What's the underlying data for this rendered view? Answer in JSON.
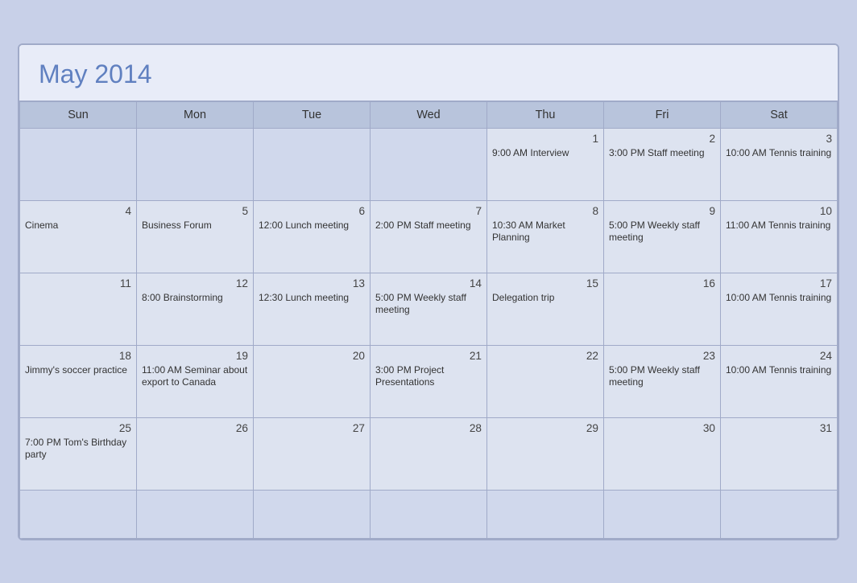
{
  "calendar": {
    "title": "May 2014",
    "headers": [
      "Sun",
      "Mon",
      "Tue",
      "Wed",
      "Thu",
      "Fri",
      "Sat"
    ],
    "weeks": [
      [
        {
          "day": "",
          "event": "",
          "empty": true
        },
        {
          "day": "",
          "event": "",
          "empty": true
        },
        {
          "day": "",
          "event": "",
          "empty": true
        },
        {
          "day": "",
          "event": "",
          "empty": true
        },
        {
          "day": "1",
          "event": "9:00 AM Interview",
          "empty": false
        },
        {
          "day": "2",
          "event": "3:00 PM Staff meeting",
          "empty": false
        },
        {
          "day": "3",
          "event": "10:00 AM Tennis training",
          "empty": false
        }
      ],
      [
        {
          "day": "4",
          "event": "Cinema",
          "empty": false
        },
        {
          "day": "5",
          "event": "Business Forum",
          "empty": false
        },
        {
          "day": "6",
          "event": "12:00 Lunch meeting",
          "empty": false
        },
        {
          "day": "7",
          "event": "2:00 PM Staff meeting",
          "empty": false
        },
        {
          "day": "8",
          "event": "10:30 AM Market Planning",
          "empty": false
        },
        {
          "day": "9",
          "event": "5:00 PM Weekly staff meeting",
          "empty": false
        },
        {
          "day": "10",
          "event": "11:00 AM Tennis training",
          "empty": false
        }
      ],
      [
        {
          "day": "11",
          "event": "",
          "empty": false
        },
        {
          "day": "12",
          "event": "8:00 Brainstorming",
          "empty": false
        },
        {
          "day": "13",
          "event": "12:30 Lunch meeting",
          "empty": false
        },
        {
          "day": "14",
          "event": "5:00 PM Weekly staff meeting",
          "empty": false
        },
        {
          "day": "15",
          "event": "Delegation trip",
          "empty": false
        },
        {
          "day": "16",
          "event": "",
          "empty": false
        },
        {
          "day": "17",
          "event": "10:00 AM Tennis training",
          "empty": false
        }
      ],
      [
        {
          "day": "18",
          "event": "Jimmy's soccer practice",
          "empty": false
        },
        {
          "day": "19",
          "event": "11:00 AM Seminar about export to Canada",
          "empty": false
        },
        {
          "day": "20",
          "event": "",
          "empty": false
        },
        {
          "day": "21",
          "event": "3:00 PM Project Presentations",
          "empty": false
        },
        {
          "day": "22",
          "event": "",
          "empty": false
        },
        {
          "day": "23",
          "event": "5:00 PM Weekly staff meeting",
          "empty": false
        },
        {
          "day": "24",
          "event": "10:00 AM Tennis training",
          "empty": false
        }
      ],
      [
        {
          "day": "25",
          "event": "7:00 PM Tom's Birthday party",
          "empty": false
        },
        {
          "day": "26",
          "event": "",
          "empty": false
        },
        {
          "day": "27",
          "event": "",
          "empty": false
        },
        {
          "day": "28",
          "event": "",
          "empty": false
        },
        {
          "day": "29",
          "event": "",
          "empty": false
        },
        {
          "day": "30",
          "event": "",
          "empty": false
        },
        {
          "day": "31",
          "event": "",
          "empty": false
        }
      ],
      [
        {
          "day": "",
          "event": "",
          "empty": true
        },
        {
          "day": "",
          "event": "",
          "empty": true
        },
        {
          "day": "",
          "event": "",
          "empty": true
        },
        {
          "day": "",
          "event": "",
          "empty": true
        },
        {
          "day": "",
          "event": "",
          "empty": true
        },
        {
          "day": "",
          "event": "",
          "empty": true
        },
        {
          "day": "",
          "event": "",
          "empty": true
        }
      ]
    ]
  }
}
